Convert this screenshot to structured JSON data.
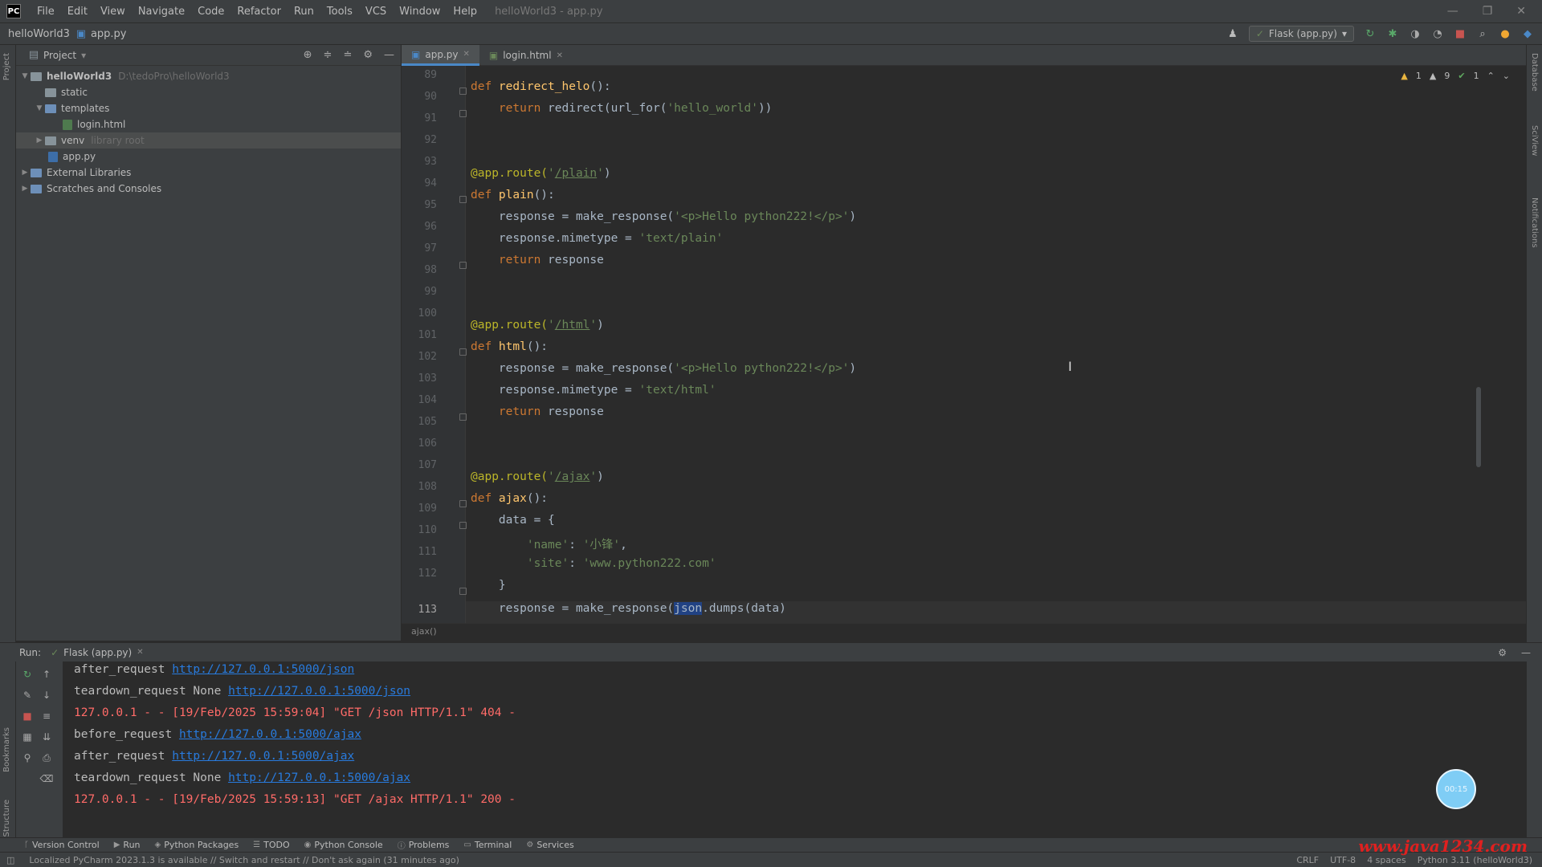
{
  "menubar": {
    "logo": "PC",
    "items": [
      "File",
      "Edit",
      "View",
      "Navigate",
      "Code",
      "Refactor",
      "Run",
      "Tools",
      "VCS",
      "Window",
      "Help"
    ],
    "title": "helloWorld3 - app.py"
  },
  "navbar": {
    "project": "helloWorld3",
    "file": "app.py",
    "run_config": "Flask (app.py)"
  },
  "project_panel": {
    "label": "Project",
    "tree": [
      {
        "label": "helloWorld3",
        "hint": "D:\\tedoPro\\helloWorld3",
        "type": "folder",
        "expanded": true
      },
      {
        "label": "static",
        "type": "folder"
      },
      {
        "label": "templates",
        "type": "folder",
        "expanded": true
      },
      {
        "label": "login.html",
        "type": "file"
      },
      {
        "label": "venv",
        "hint": "library root",
        "type": "folder"
      },
      {
        "label": "app.py",
        "type": "file-py"
      },
      {
        "label": "External Libraries",
        "type": "lib"
      },
      {
        "label": "Scratches and Consoles",
        "type": "scratch"
      }
    ]
  },
  "editor": {
    "tabs": [
      {
        "label": "app.py",
        "active": true
      },
      {
        "label": "login.html",
        "active": false
      }
    ],
    "status": {
      "warnings": "1",
      "weak_warnings": "9",
      "ok": "1"
    },
    "breadcrumb": "ajax()",
    "lines": [
      {
        "n": "89",
        "text": ""
      },
      {
        "n": "90",
        "text": ""
      },
      {
        "n": "91",
        "text": ""
      },
      {
        "n": "92",
        "text": ""
      },
      {
        "n": "93",
        "text": ""
      },
      {
        "n": "94",
        "text": ""
      },
      {
        "n": "95",
        "text": ""
      },
      {
        "n": "96",
        "text": ""
      },
      {
        "n": "97",
        "text": ""
      },
      {
        "n": "98",
        "text": ""
      },
      {
        "n": "99",
        "text": ""
      },
      {
        "n": "100",
        "text": ""
      },
      {
        "n": "101",
        "text": ""
      },
      {
        "n": "102",
        "text": ""
      },
      {
        "n": "103",
        "text": ""
      },
      {
        "n": "104",
        "text": ""
      },
      {
        "n": "105",
        "text": ""
      },
      {
        "n": "106",
        "text": ""
      },
      {
        "n": "107",
        "text": ""
      },
      {
        "n": "108",
        "text": ""
      },
      {
        "n": "109",
        "text": ""
      },
      {
        "n": "110",
        "text": ""
      },
      {
        "n": "111",
        "text": ""
      },
      {
        "n": "112",
        "text": ""
      },
      {
        "n": "113",
        "text": ""
      }
    ],
    "code": {
      "l89_kw": "def ",
      "l89_fn": "redirect_helo",
      "l89_rest": "():",
      "l90_kw": "return ",
      "l90_a": "redirect(url_for(",
      "l90_str": "'hello_world'",
      "l90_b": "))",
      "l93_deco": "@app.route(",
      "l93_str1": "'",
      "l93_link": "/plain",
      "l93_str2": "'",
      "l93_end": ")",
      "l94_kw": "def ",
      "l94_fn": "plain",
      "l94_rest": "():",
      "l95_a": "response = make_response(",
      "l95_str": "'<p>Hello python222!</p>'",
      "l95_b": ")",
      "l96_a": "response.mimetype = ",
      "l96_str": "'text/plain'",
      "l97_kw": "return ",
      "l97_a": "response",
      "l100_deco": "@app.route(",
      "l100_str1": "'",
      "l100_link": "/html",
      "l100_str2": "'",
      "l100_end": ")",
      "l101_kw": "def ",
      "l101_fn": "html",
      "l101_rest": "():",
      "l102_a": "response = make_response(",
      "l102_str": "'<p>Hello python222!</p>'",
      "l102_b": ")",
      "l103_a": "response.mimetype = ",
      "l103_str": "'text/html'",
      "l104_kw": "return ",
      "l104_a": "response",
      "l107_deco": "@app.route(",
      "l107_str1": "'",
      "l107_link": "/ajax",
      "l107_str2": "'",
      "l107_end": ")",
      "l108_kw": "def ",
      "l108_fn": "ajax",
      "l108_rest": "():",
      "l109_a": "data = {",
      "l110_str1": "'name'",
      "l110_a": ": ",
      "l110_str2": "'小锋'",
      "l110_b": ",",
      "l111_str1": "'site'",
      "l111_a": ": ",
      "l111_str2": "'www.python222.com'",
      "l112_a": "}",
      "l113_a": "response = make_response(",
      "l113_sel": "json",
      "l113_b": ".dumps(data)"
    }
  },
  "run_panel": {
    "label": "Run:",
    "tab": "Flask (app.py)",
    "console": [
      {
        "prefix": "after_request ",
        "link": "http://127.0.0.1:5000/json",
        "err": false
      },
      {
        "prefix": "teardown_request None ",
        "link": "http://127.0.0.1:5000/json",
        "err": false
      },
      {
        "prefix": "127.0.0.1 - - [19/Feb/2025 15:59:04] \"GET /json HTTP/1.1\" 404 -",
        "link": "",
        "err": true
      },
      {
        "prefix": "before_request ",
        "link": "http://127.0.0.1:5000/ajax",
        "err": false
      },
      {
        "prefix": "after_request ",
        "link": "http://127.0.0.1:5000/ajax",
        "err": false
      },
      {
        "prefix": "teardown_request None ",
        "link": "http://127.0.0.1:5000/ajax",
        "err": false
      },
      {
        "prefix": "127.0.0.1 - - [19/Feb/2025 15:59:13] \"GET /ajax HTTP/1.1\" 200 -",
        "link": "",
        "err": true
      }
    ],
    "bubble": "00:15"
  },
  "bottom_tools": [
    "Version Control",
    "Run",
    "Python Packages",
    "TODO",
    "Python Console",
    "Problems",
    "Terminal",
    "Services"
  ],
  "statusbar": {
    "message": "Localized PyCharm 2023.1.3 is available // Switch and restart // Don't ask again (31 minutes ago)",
    "line_sep": "CRLF",
    "encoding": "UTF-8",
    "indent": "4 spaces",
    "interpreter": "Python 3.11 (helloWorld3)"
  },
  "watermark": "www.java1234.com",
  "colors": {
    "keyword": "#cc7832",
    "function": "#ffc66d",
    "string": "#6a8759",
    "decorator": "#bbb529",
    "error": "#ff6b68",
    "link": "#287bde"
  }
}
